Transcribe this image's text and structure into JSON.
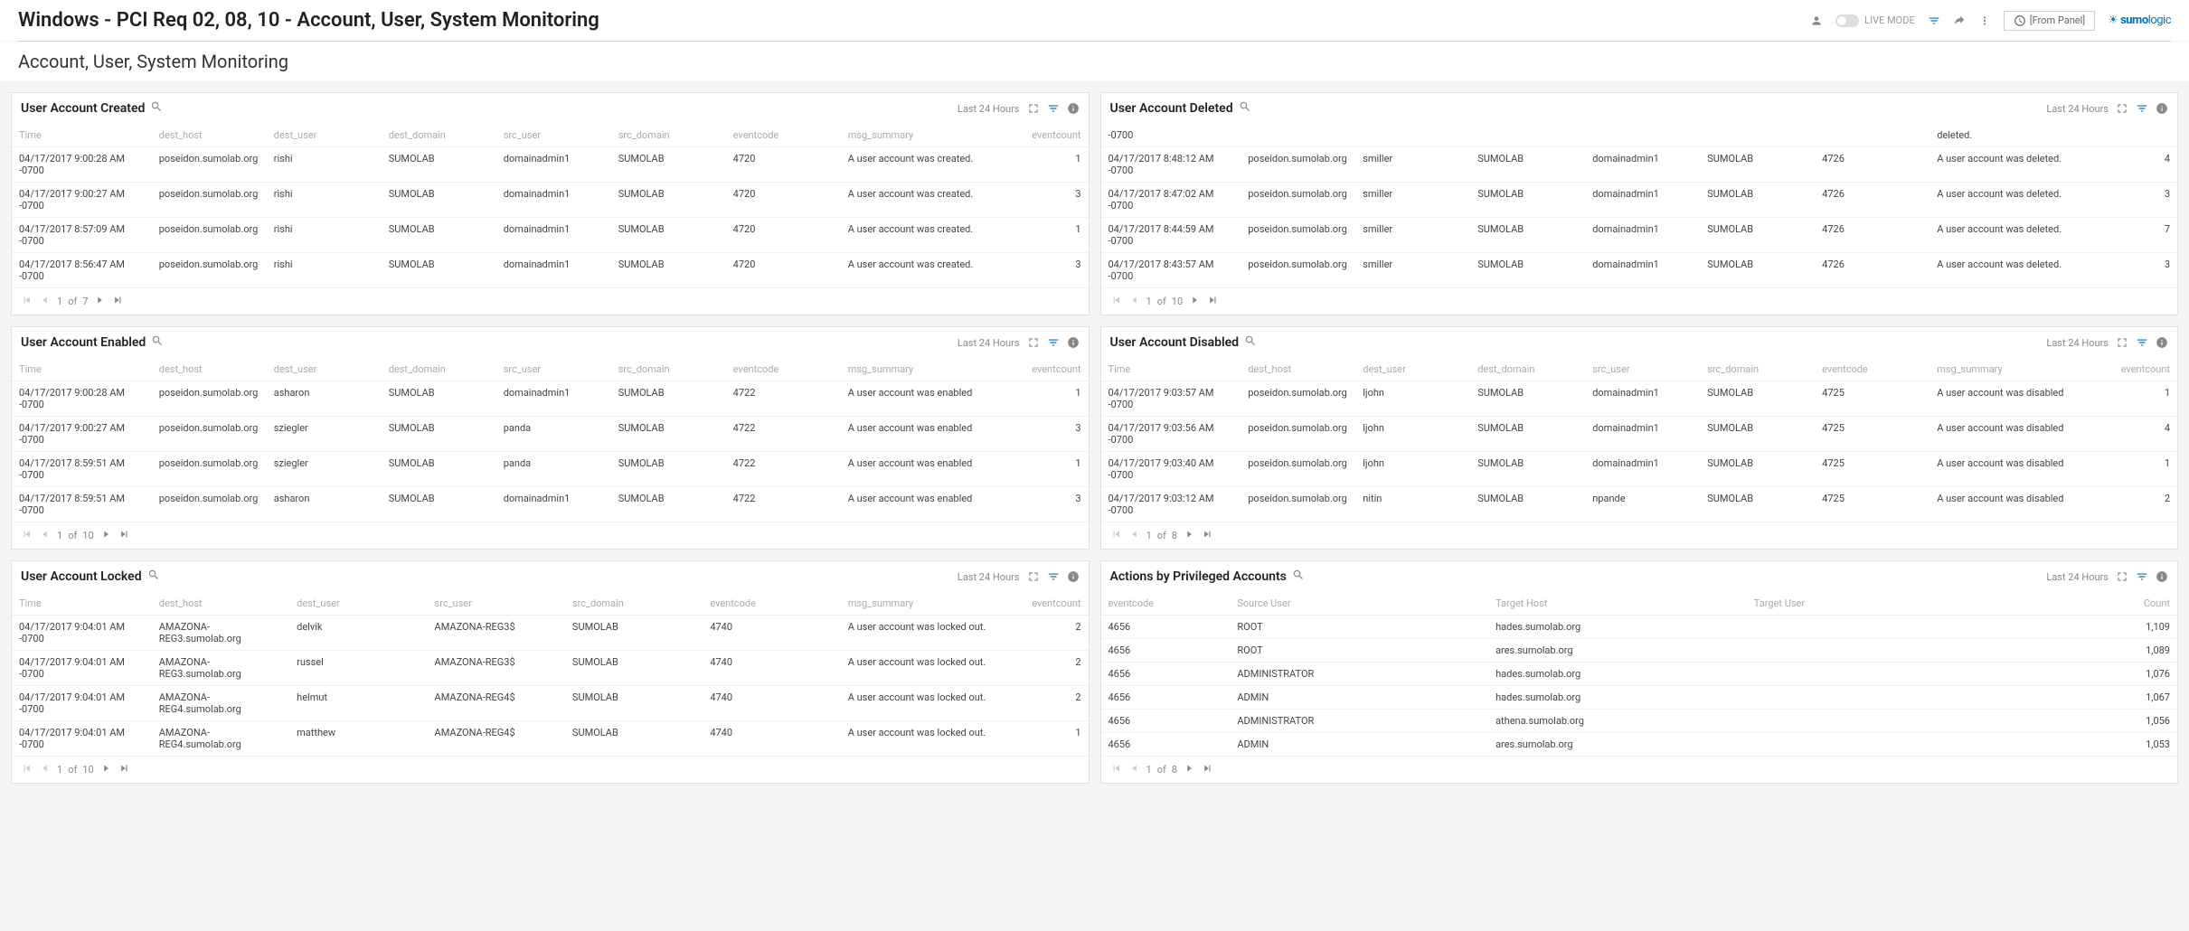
{
  "header": {
    "title": "Windows - PCI Req 02, 08, 10 - Account, User, System Monitoring",
    "live_mode_label": "LIVE MODE",
    "from_panel": "[From Panel]",
    "brand": "sumologic"
  },
  "subtitle": "Account, User, System Monitoring",
  "time_label": "Last 24 Hours",
  "pager_of": "of",
  "columns_std": [
    "Time",
    "dest_host",
    "dest_user",
    "dest_domain",
    "src_user",
    "src_domain",
    "eventcode",
    "msg_summary",
    "eventcount"
  ],
  "columns_locked": [
    "Time",
    "dest_host",
    "dest_user",
    "src_user",
    "src_domain",
    "eventcode",
    "msg_summary",
    "eventcount"
  ],
  "columns_priv": [
    "eventcode",
    "Source User",
    "Target Host",
    "Target User",
    "Count"
  ],
  "panels": {
    "created": {
      "title": "User Account Created",
      "page": "1",
      "pages": "7",
      "rows": [
        [
          "04/17/2017 9:00:28 AM -0700",
          "poseidon.sumolab.org",
          "rishi",
          "SUMOLAB",
          "domainadmin1",
          "SUMOLAB",
          "4720",
          "A user account was created.",
          "1"
        ],
        [
          "04/17/2017 9:00:27 AM -0700",
          "poseidon.sumolab.org",
          "rishi",
          "SUMOLAB",
          "domainadmin1",
          "SUMOLAB",
          "4720",
          "A user account was created.",
          "3"
        ],
        [
          "04/17/2017 8:57:09 AM -0700",
          "poseidon.sumolab.org",
          "rishi",
          "SUMOLAB",
          "domainadmin1",
          "SUMOLAB",
          "4720",
          "A user account was created.",
          "1"
        ],
        [
          "04/17/2017 8:56:47 AM -0700",
          "poseidon.sumolab.org",
          "rishi",
          "SUMOLAB",
          "domainadmin1",
          "SUMOLAB",
          "4720",
          "A user account was created.",
          "3"
        ]
      ]
    },
    "deleted": {
      "title": "User Account Deleted",
      "page": "1",
      "pages": "10",
      "rows": [
        [
          "-0700",
          "",
          "",
          "",
          "",
          "",
          "",
          "deleted.",
          ""
        ],
        [
          "04/17/2017 8:48:12 AM -0700",
          "poseidon.sumolab.org",
          "smiller",
          "SUMOLAB",
          "domainadmin1",
          "SUMOLAB",
          "4726",
          "A user account was deleted.",
          "4"
        ],
        [
          "04/17/2017 8:47:02 AM -0700",
          "poseidon.sumolab.org",
          "smiller",
          "SUMOLAB",
          "domainadmin1",
          "SUMOLAB",
          "4726",
          "A user account was deleted.",
          "3"
        ],
        [
          "04/17/2017 8:44:59 AM -0700",
          "poseidon.sumolab.org",
          "smiller",
          "SUMOLAB",
          "domainadmin1",
          "SUMOLAB",
          "4726",
          "A user account was deleted.",
          "7"
        ],
        [
          "04/17/2017 8:43:57 AM -0700",
          "poseidon.sumolab.org",
          "smiller",
          "SUMOLAB",
          "domainadmin1",
          "SUMOLAB",
          "4726",
          "A user account was deleted.",
          "3"
        ]
      ]
    },
    "enabled": {
      "title": "User Account Enabled",
      "page": "1",
      "pages": "10",
      "rows": [
        [
          "04/17/2017 9:00:28 AM -0700",
          "poseidon.sumolab.org",
          "asharon",
          "SUMOLAB",
          "domainadmin1",
          "SUMOLAB",
          "4722",
          "A user account was enabled",
          "1"
        ],
        [
          "04/17/2017 9:00:27 AM -0700",
          "poseidon.sumolab.org",
          "sziegler",
          "SUMOLAB",
          "panda",
          "SUMOLAB",
          "4722",
          "A user account was enabled",
          "3"
        ],
        [
          "04/17/2017 8:59:51 AM -0700",
          "poseidon.sumolab.org",
          "sziegler",
          "SUMOLAB",
          "panda",
          "SUMOLAB",
          "4722",
          "A user account was enabled",
          "1"
        ],
        [
          "04/17/2017 8:59:51 AM -0700",
          "poseidon.sumolab.org",
          "asharon",
          "SUMOLAB",
          "domainadmin1",
          "SUMOLAB",
          "4722",
          "A user account was enabled",
          "3"
        ]
      ]
    },
    "disabled": {
      "title": "User Account Disabled",
      "page": "1",
      "pages": "8",
      "rows": [
        [
          "04/17/2017 9:03:57 AM -0700",
          "poseidon.sumolab.org",
          "ljohn",
          "SUMOLAB",
          "domainadmin1",
          "SUMOLAB",
          "4725",
          "A user account was disabled",
          "1"
        ],
        [
          "04/17/2017 9:03:56 AM -0700",
          "poseidon.sumolab.org",
          "ljohn",
          "SUMOLAB",
          "domainadmin1",
          "SUMOLAB",
          "4725",
          "A user account was disabled",
          "4"
        ],
        [
          "04/17/2017 9:03:40 AM -0700",
          "poseidon.sumolab.org",
          "ljohn",
          "SUMOLAB",
          "domainadmin1",
          "SUMOLAB",
          "4725",
          "A user account was disabled",
          "1"
        ],
        [
          "04/17/2017 9:03:12 AM -0700",
          "poseidon.sumolab.org",
          "nitin",
          "SUMOLAB",
          "npande",
          "SUMOLAB",
          "4725",
          "A user account was disabled",
          "2"
        ]
      ]
    },
    "locked": {
      "title": "User Account Locked",
      "page": "1",
      "pages": "10",
      "rows": [
        [
          "04/17/2017 9:04:01 AM -0700",
          "AMAZONA-REG3.sumolab.org",
          "delvik",
          "AMAZONA-REG3$",
          "SUMOLAB",
          "4740",
          "A user account was locked out.",
          "2"
        ],
        [
          "04/17/2017 9:04:01 AM -0700",
          "AMAZONA-REG3.sumolab.org",
          "russel",
          "AMAZONA-REG3$",
          "SUMOLAB",
          "4740",
          "A user account was locked out.",
          "2"
        ],
        [
          "04/17/2017 9:04:01 AM -0700",
          "AMAZONA-REG4.sumolab.org",
          "helmut",
          "AMAZONA-REG4$",
          "SUMOLAB",
          "4740",
          "A user account was locked out.",
          "2"
        ],
        [
          "04/17/2017 9:04:01 AM -0700",
          "AMAZONA-REG4.sumolab.org",
          "matthew",
          "AMAZONA-REG4$",
          "SUMOLAB",
          "4740",
          "A user account was locked out.",
          "1"
        ]
      ]
    },
    "priv": {
      "title": "Actions by Privileged Accounts",
      "page": "1",
      "pages": "8",
      "rows": [
        [
          "4656",
          "ROOT",
          "hades.sumolab.org",
          "",
          "1,109"
        ],
        [
          "4656",
          "ROOT",
          "ares.sumolab.org",
          "",
          "1,089"
        ],
        [
          "4656",
          "ADMINISTRATOR",
          "hades.sumolab.org",
          "",
          "1,076"
        ],
        [
          "4656",
          "ADMIN",
          "hades.sumolab.org",
          "",
          "1,067"
        ],
        [
          "4656",
          "ADMINISTRATOR",
          "athena.sumolab.org",
          "",
          "1,056"
        ],
        [
          "4656",
          "ADMIN",
          "ares.sumolab.org",
          "",
          "1,053"
        ]
      ]
    }
  }
}
